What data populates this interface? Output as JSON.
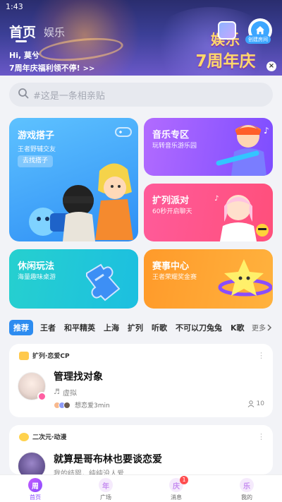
{
  "status": {
    "time": "1:43"
  },
  "header": {
    "tabs": [
      {
        "label": "首页",
        "active": true
      },
      {
        "label": "娱乐",
        "active": false
      }
    ],
    "greeting": "Hi, 莫兮",
    "promo": "7周年庆福利领不停!",
    "promo_arrow": ">>",
    "banner_logo_line1": "娱乐",
    "banner_logo_line2": "7周年庆",
    "create_room_label": "创建房间"
  },
  "search": {
    "placeholder": "#这是一条相亲贴"
  },
  "cards": {
    "game": {
      "title": "游戏搭子",
      "subtitle": "王者野辅交友",
      "button": "去找搭子"
    },
    "music": {
      "title": "音乐专区",
      "subtitle": "玩转音乐游乐园"
    },
    "party": {
      "title": "扩列派对",
      "subtitle": "60秒开启聊天"
    },
    "casual": {
      "title": "休闲玩法",
      "subtitle": "海量趣味桌游"
    },
    "match": {
      "title": "赛事中心",
      "subtitle": "王者荣耀奖金赛"
    }
  },
  "category_tabs": {
    "items": [
      "推荐",
      "王者",
      "和平精英",
      "上海",
      "扩列",
      "听歌",
      "不可以刀兔兔",
      "K歌"
    ],
    "active": "推荐",
    "more": "更多"
  },
  "posts": [
    {
      "tag": "扩列·恋爱CP",
      "title": "管理找对象",
      "subtitle": "虚拟",
      "meta": "想恋爱3min",
      "count": "10"
    },
    {
      "tag": "二次元·动漫",
      "title": "就算是哥布林也要谈恋爱",
      "subtitle": "我的结婴，纯纯没人爱"
    }
  ],
  "bottom_nav": {
    "items": [
      {
        "icon_char": "周",
        "label": "首页",
        "active": true
      },
      {
        "icon_char": "年",
        "label": "广场",
        "active": false
      },
      {
        "icon_char": "庆",
        "label": "消息",
        "active": false,
        "badge": "1"
      },
      {
        "icon_char": "乐",
        "label": "我的",
        "active": false
      }
    ]
  },
  "colors": {
    "accent": "#2d8cf0",
    "nav_active": "#8a4dff",
    "game_card": "#3aa4f8",
    "music_card": "#9a5cff",
    "party_card": "#ff5590",
    "casual_card": "#22c8d8",
    "match_card": "#ffa634"
  }
}
